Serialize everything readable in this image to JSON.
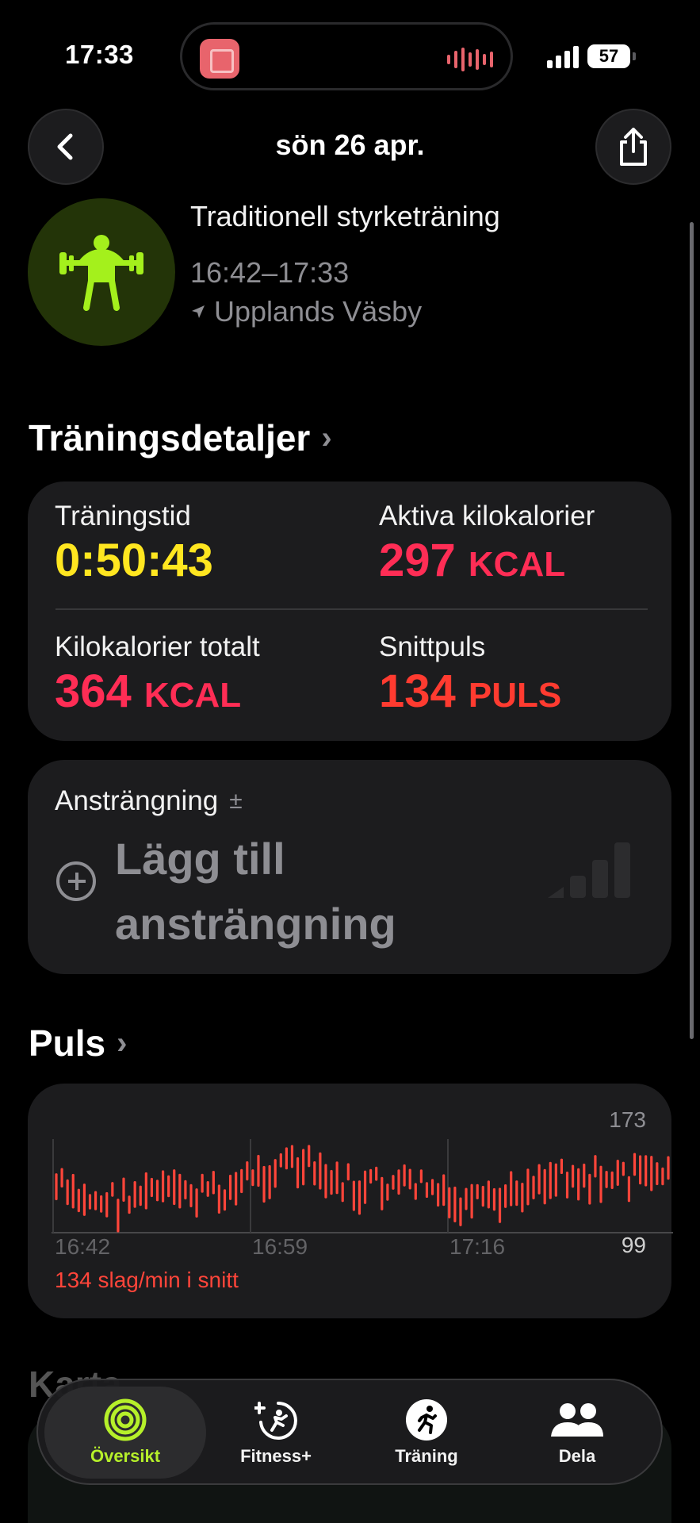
{
  "status": {
    "time": "17:33",
    "battery": "57"
  },
  "header": {
    "title": "sön 26 apr."
  },
  "workout": {
    "name": "Traditionell styrketräning",
    "time_range": "16:42–17:33",
    "location": "Upplands Väsby"
  },
  "details": {
    "section_title": "Träningsdetaljer",
    "metrics": [
      {
        "label": "Träningstid",
        "value": "0:50:43",
        "unit": "",
        "color": "#ffe620"
      },
      {
        "label": "Aktiva kilokalorier",
        "value": "297",
        "unit": "KCAL",
        "color": "#ff2d55"
      },
      {
        "label": "Kilokalorier totalt",
        "value": "364",
        "unit": "KCAL",
        "color": "#ff2d55"
      },
      {
        "label": "Snittpuls",
        "value": "134",
        "unit": "PULS",
        "color": "#ff3b30"
      }
    ]
  },
  "effort": {
    "label": "Ansträngning",
    "label_symbol": "±",
    "add_text": "Lägg till ansträngning"
  },
  "heart_rate": {
    "section_title": "Puls",
    "max_label": "173",
    "min_label": "99",
    "x_ticks": [
      "16:42",
      "16:59",
      "17:16"
    ],
    "average_text": "134 slag/min i snitt",
    "accent": "#ff453a"
  },
  "map": {
    "section_title": "Karta"
  },
  "tabbar": {
    "tabs": [
      {
        "label": "Översikt",
        "icon": "activity-rings-icon",
        "active": true
      },
      {
        "label": "Fitness+",
        "icon": "fitness-plus-icon",
        "active": false
      },
      {
        "label": "Träning",
        "icon": "workout-runner-icon",
        "active": false
      },
      {
        "label": "Dela",
        "icon": "people-icon",
        "active": false
      }
    ]
  }
}
